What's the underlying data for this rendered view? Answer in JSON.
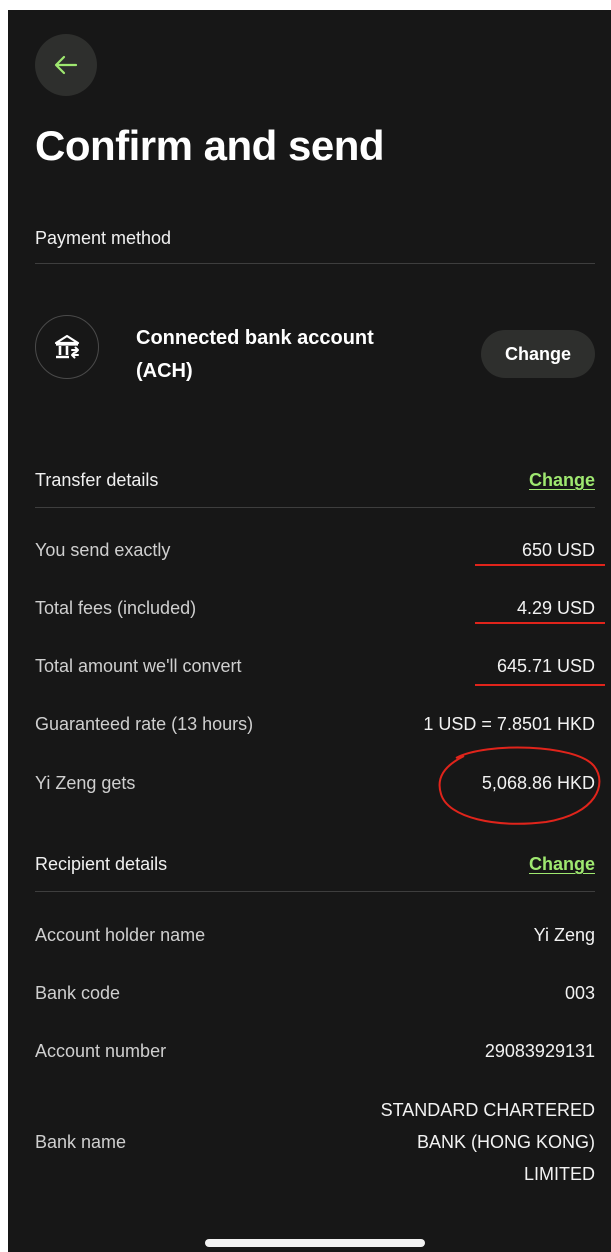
{
  "header": {
    "title": "Confirm and send"
  },
  "payment_method": {
    "heading": "Payment method",
    "method_line1": "Connected bank account",
    "method_line2": "(ACH)",
    "icon": "bank-icon",
    "change_label": "Change"
  },
  "transfer_details": {
    "heading": "Transfer details",
    "change_label": "Change",
    "rows": [
      {
        "label": "You send exactly",
        "value": "650 USD"
      },
      {
        "label": "Total fees (included)",
        "value": "4.29 USD"
      },
      {
        "label": "Total amount we'll convert",
        "value": "645.71 USD"
      },
      {
        "label": "Guaranteed rate (13 hours)",
        "value": "1 USD = 7.8501 HKD"
      },
      {
        "label": "Yi Zeng gets",
        "value": "5,068.86 HKD"
      }
    ]
  },
  "recipient_details": {
    "heading": "Recipient details",
    "change_label": "Change",
    "rows": [
      {
        "label": "Account holder name",
        "value": "Yi Zeng"
      },
      {
        "label": "Bank code",
        "value": "003"
      },
      {
        "label": "Account number",
        "value": "29083929131"
      }
    ],
    "bank_name": {
      "label": "Bank name",
      "value_lines": [
        "STANDARD CHARTERED",
        "BANK (HONG KONG)",
        "LIMITED"
      ]
    }
  },
  "colors": {
    "background": "#171717",
    "accent_green": "#9fe870",
    "annotation_red": "#e0241b"
  }
}
